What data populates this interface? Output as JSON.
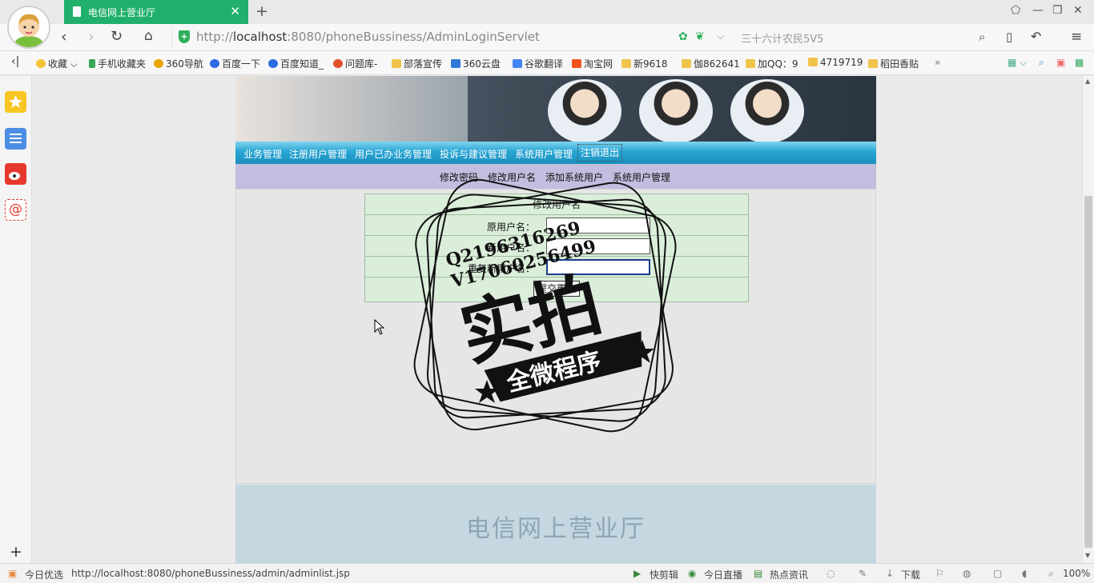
{
  "browser": {
    "tab_title": "电信网上营业厅",
    "url_host": "localhost",
    "url_rest": ":8080/phoneBussiness/AdminLoginServlet",
    "url_prefix": "http://",
    "search_text": "三十六计农民5V5"
  },
  "bookmarks": [
    {
      "label": "收藏",
      "icon": "star-icon"
    },
    {
      "label": "手机收藏夹",
      "icon": "phone-icon"
    },
    {
      "label": "360导航",
      "icon": "360-icon"
    },
    {
      "label": "百度一下",
      "icon": "baidu-icon"
    },
    {
      "label": "百度知道_",
      "icon": "baidu-icon"
    },
    {
      "label": "问题库-",
      "icon": "sogou-icon"
    },
    {
      "label": "部落宣传",
      "icon": "folder-icon"
    },
    {
      "label": "360云盘",
      "icon": "cloud-icon"
    },
    {
      "label": "谷歌翻译",
      "icon": "translate-icon"
    },
    {
      "label": "淘宝网",
      "icon": "taobao-icon"
    },
    {
      "label": "新9618",
      "icon": "folder-icon"
    },
    {
      "label": "伽862641",
      "icon": "folder-icon"
    },
    {
      "label": "加QQ：9",
      "icon": "folder-icon"
    },
    {
      "label": "4719719",
      "icon": "folder-icon"
    },
    {
      "label": "稻田香贴",
      "icon": "folder-icon"
    }
  ],
  "main_nav": [
    "业务管理",
    "注册用户管理",
    "用户已办业务管理",
    "投诉与建议管理",
    "系统用户管理",
    "注销退出"
  ],
  "sub_nav": [
    "修改密码",
    "修改用户名",
    "添加系统用户",
    "系统用户管理"
  ],
  "form": {
    "title": "修改用户名",
    "fields": [
      {
        "label": "原用户名：",
        "value": ""
      },
      {
        "label": "新用户名：",
        "value": ""
      },
      {
        "label": "重复新用户名：",
        "value": ""
      }
    ],
    "submit_label": "提交更改"
  },
  "footer_text": "电信网上营业厅",
  "watermark": {
    "line1": "Q2196316269",
    "line2": "V17060256499",
    "main": "实拍",
    "banner": "全微程序"
  },
  "status": {
    "left_label": "今日优选",
    "link": "http://localhost:8080/phoneBussiness/admin/adminlist.jsp",
    "items": [
      "快剪辑",
      "今日直播",
      "热点资讯",
      "下载"
    ],
    "zoom": "100%"
  }
}
